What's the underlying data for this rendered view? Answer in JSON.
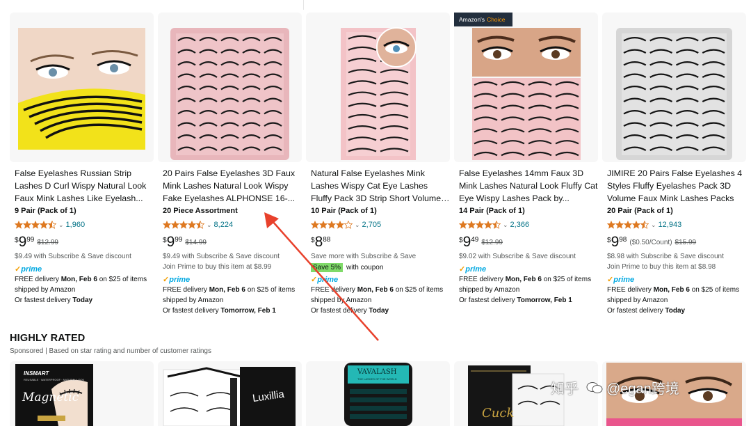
{
  "products": [
    {
      "title": "False Eyelashes Russian Strip Lashes D Curl Wispy Natural Look Faux Mink Lashes Like Eyelash...",
      "variant": "9 Pair (Pack of 1)",
      "rating": 4.5,
      "rating_count": "1,960",
      "price_symbol": "$",
      "price_whole": "9",
      "price_fraction": "99",
      "unit_price": "",
      "list_price": "$12.99",
      "line1": "$9.49 with Subscribe & Save discount",
      "line2": "",
      "coupon_badge": "",
      "coupon_text": "",
      "prime": "prime",
      "delivery": {
        "pre": "FREE delivery ",
        "date": "Mon, Feb 6",
        "mid": " on $25 of items shipped by Amazon"
      },
      "fastest": {
        "pre": "Or fastest delivery ",
        "date": "Today"
      },
      "amazons_choice": false
    },
    {
      "title": "20 Pairs False Eyelashes 3D Faux Mink Lashes Natural Look Wispy Fake Eyelashes ALPHONSE 16-...",
      "variant": "20 Piece Assortment",
      "rating": 4.5,
      "rating_count": "8,224",
      "price_symbol": "$",
      "price_whole": "9",
      "price_fraction": "99",
      "unit_price": "",
      "list_price": "$14.99",
      "line1": "$9.49 with Subscribe & Save discount",
      "line2": "Join Prime to buy this item at $8.99",
      "coupon_badge": "",
      "coupon_text": "",
      "prime": "prime",
      "delivery": {
        "pre": "FREE delivery ",
        "date": "Mon, Feb 6",
        "mid": " on $25 of items shipped by Amazon"
      },
      "fastest": {
        "pre": "Or fastest delivery ",
        "date": "Tomorrow, Feb 1"
      },
      "amazons_choice": false
    },
    {
      "title": "Natural False Eyelashes Mink Lashes Wispy Cat Eye Lashes Fluffy Pack 3D Strip Short Volume Fake...",
      "variant": "10 Pair (Pack of 1)",
      "rating": 4.0,
      "rating_count": "2,705",
      "price_symbol": "$",
      "price_whole": "8",
      "price_fraction": "88",
      "unit_price": "",
      "list_price": "",
      "line1": "Save more with Subscribe & Save",
      "line2": "",
      "coupon_badge": "Save 5%",
      "coupon_text": "with coupon",
      "prime": "prime",
      "delivery": {
        "pre": "FREE delivery ",
        "date": "Mon, Feb 6",
        "mid": " on $25 of items shipped by Amazon"
      },
      "fastest": {
        "pre": "Or fastest delivery ",
        "date": "Today"
      },
      "amazons_choice": false
    },
    {
      "title": "False Eyelashes 14mm Faux 3D Mink Lashes Natural Look Fluffy Cat Eye Wispy Lashes Pack by...",
      "variant": "14 Pair (Pack of 1)",
      "rating": 4.5,
      "rating_count": "2,366",
      "price_symbol": "$",
      "price_whole": "9",
      "price_fraction": "49",
      "unit_price": "",
      "list_price": "$12.99",
      "line1": "$9.02 with Subscribe & Save discount",
      "line2": "",
      "coupon_badge": "",
      "coupon_text": "",
      "prime": "prime",
      "delivery": {
        "pre": "FREE delivery ",
        "date": "Mon, Feb 6",
        "mid": " on $25 of items shipped by Amazon"
      },
      "fastest": {
        "pre": "Or fastest delivery ",
        "date": "Tomorrow, Feb 1"
      },
      "amazons_choice": true
    },
    {
      "title": "JIMIRE 20 Pairs False Eyelashes 4 Styles Fluffy Eyelashes Pack 3D Volume Faux Mink Lashes Packs",
      "variant": "20 Pair (Pack of 1)",
      "rating": 4.5,
      "rating_count": "12,943",
      "price_symbol": "$",
      "price_whole": "9",
      "price_fraction": "98",
      "unit_price": "($0.50/Count)",
      "list_price": "$15.99",
      "line1": "$8.98 with Subscribe & Save discount",
      "line2": "Join Prime to buy this item at $8.98",
      "coupon_badge": "",
      "coupon_text": "",
      "prime": "prime",
      "delivery": {
        "pre": "FREE delivery ",
        "date": "Mon, Feb 6",
        "mid": " on $25 of items shipped by Amazon"
      },
      "fastest": {
        "pre": "Or fastest delivery ",
        "date": "Today"
      },
      "amazons_choice": false
    }
  ],
  "amazons_choice": {
    "prefix": "Amazon's",
    "highlight": "Choice"
  },
  "section": {
    "title": "HIGHLY RATED",
    "subtitle": "Sponsored | Based on star rating and number of customer ratings"
  },
  "bottom_products": [
    {
      "brand": "INSMART",
      "tagline": "REUSABLE · WATERPROOF · NATURAL LOOK",
      "script": "Magnetic"
    },
    {
      "brand": "Luxillia"
    },
    {
      "brand": "VAVALASH",
      "tagline": "THE LASHES OF THE WORLD"
    },
    {
      "brand": "Cuck"
    },
    {
      "brand": ""
    }
  ],
  "watermark": {
    "site": "知乎",
    "account": "@egan跨境"
  },
  "colors": {
    "star": "#de7921",
    "link": "#007185",
    "prime": "#00a8e1",
    "coupon": "#7fda69",
    "choice_bg": "#232f3e",
    "choice_accent": "#ff9900",
    "arrow": "#e8412c"
  }
}
